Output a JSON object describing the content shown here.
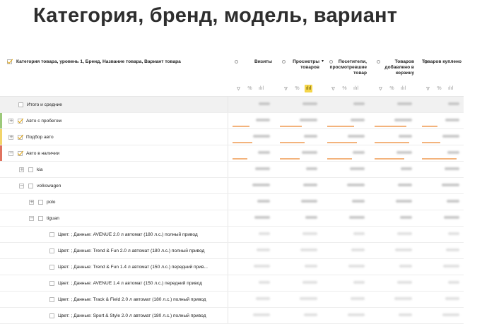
{
  "slide_title": "Категория, бренд, модель, вариант",
  "report": {
    "dimension_header": "Категория товара, уровень 1, Бренд, Название товара, Вариант товара",
    "columns": [
      {
        "title": "Визиты",
        "sort": false
      },
      {
        "title": "Просмотры товаров",
        "sort": true
      },
      {
        "title": "Посетители, просмотревшие товар",
        "sort": false
      },
      {
        "title": "Товаров добавлено в корзину",
        "sort": false
      },
      {
        "title": "Товаров куплено",
        "sort": false
      }
    ],
    "tools": {
      "filter": "∇",
      "percent": "%",
      "chart": "ılıl"
    },
    "active_chart_column": 1,
    "accent_colors": {
      "checkbox": "#e3a200",
      "bar": "#f3b37c",
      "highlight": "#f5d64a"
    },
    "rows": [
      {
        "label": "Итого и средние",
        "level": 0,
        "expander": "",
        "checked": false,
        "strip": "",
        "total": true
      },
      {
        "label": "Авто с пробегом",
        "level": 0,
        "expander": "+",
        "checked": true,
        "strip": "#9cc97a"
      },
      {
        "label": "Подбор авто",
        "level": 0,
        "expander": "+",
        "checked": true,
        "strip": "#f2d46a"
      },
      {
        "label": "Авто в наличии",
        "level": 0,
        "expander": "−",
        "checked": true,
        "strip": "#e0735f"
      },
      {
        "label": "kia",
        "level": 1,
        "expander": "+",
        "checked": false,
        "strip": ""
      },
      {
        "label": "volkswagen",
        "level": 1,
        "expander": "−",
        "checked": false,
        "strip": ""
      },
      {
        "label": "polo",
        "level": 2,
        "expander": "+",
        "checked": false,
        "strip": ""
      },
      {
        "label": "tiguan",
        "level": 2,
        "expander": "−",
        "checked": false,
        "strip": ""
      },
      {
        "label": "Цвет: ; Данные: AVENUE 2.0 л автомат (180 л.с.) полный привод",
        "level": 3,
        "expander": "",
        "checked": false,
        "strip": ""
      },
      {
        "label": "Цвет: ; Данные: Trend & Fun 2.0 л автомат (180 л.с.) полный привод",
        "level": 3,
        "expander": "",
        "checked": false,
        "strip": ""
      },
      {
        "label": "Цвет: ; Данные: Trend & Fun 1.4 л автомат (150 л.с.) передний прив...",
        "level": 3,
        "expander": "",
        "checked": false,
        "strip": ""
      },
      {
        "label": "Цвет: ; Данные: AVENUE 1.4 л автомат (150 л.с.) передний привод",
        "level": 3,
        "expander": "",
        "checked": false,
        "strip": ""
      },
      {
        "label": "Цвет: ; Данные: Track & Field 2.0 л автомат (180 л.с.) полный привод",
        "level": 3,
        "expander": "",
        "checked": false,
        "strip": ""
      },
      {
        "label": "Цвет: ; Данные: Sport & Style 2.0 л автомат (180 л.с.) полный привод",
        "level": 3,
        "expander": "",
        "checked": false,
        "strip": ""
      }
    ]
  }
}
